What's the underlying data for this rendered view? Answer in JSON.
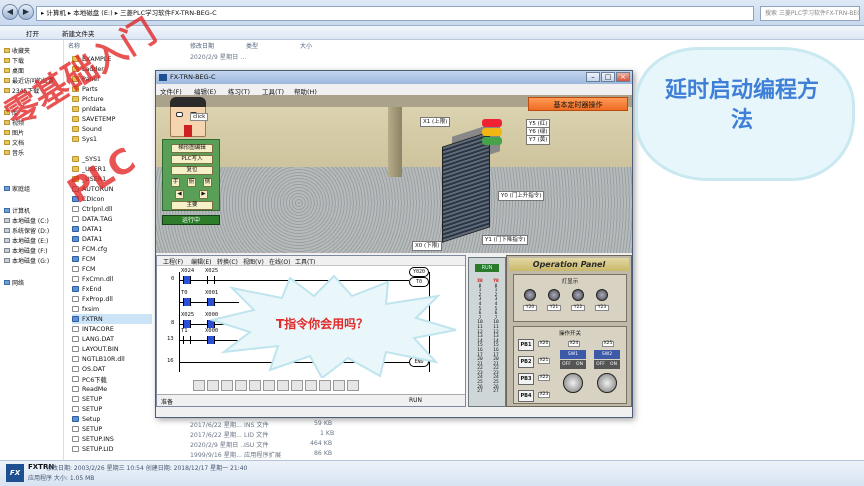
{
  "explorer": {
    "address": "▸ 计算机 ▸ 本地磁盘 (E:) ▸ 三菱PLC学习软件FX-TRN-BEG-C",
    "search_placeholder": "搜索 三菱PLC学习软件FX-TRN-BEG-C",
    "toolbar": {
      "open": "打开",
      "new_folder": "新建文件夹"
    },
    "columns": {
      "name": "名称",
      "date": "修改日期",
      "type": "类型",
      "size": "大小"
    },
    "sidebar": [
      "收藏夹",
      "下载",
      "桌面",
      "最近访问的位置",
      "2345下载",
      "库",
      "视频",
      "图片",
      "文档",
      "音乐",
      "家庭组",
      "计算机",
      "本地磁盘 (C:)",
      "系统保留 (D:)",
      "本地磁盘 (E:)",
      "本地磁盘 (F:)",
      "本地磁盘 (G:)",
      "网络"
    ],
    "files": [
      "EXAMPLE",
      "Ladder",
      "Panel",
      "Parts",
      "Picture",
      "pnldata",
      "SAVETEMP",
      "Sound",
      "Sys1",
      "_SYS1",
      "_USER1",
      "_USER1",
      "AUTORUN",
      "CDIcon",
      "Ctrlpnl.dll",
      "DATA.TAG",
      "DATA1",
      "DATA1",
      "FCM.cfg",
      "FCM",
      "FCM",
      "FxCmn.dll",
      "FxEnd",
      "FxProp.dll",
      "fxsim",
      "FXTRN",
      "INTACORE",
      "LANG.DAT",
      "LAYOUT.BIN",
      "NGTLB10R.dll",
      "OS.DAT",
      "PC6下载",
      "ReadMe",
      "SETUP",
      "SETUP",
      "Setup",
      "SETUP",
      "SETUP.INS",
      "SETUP.LID",
      "Uninst.isu",
      "Vlapi.dll"
    ],
    "details": [
      {
        "date": "2017/6/22 星期...",
        "type": "INS 文件",
        "size": "59 KB"
      },
      {
        "date": "2017/6/22 星期...",
        "type": "LID 文件",
        "size": "1 KB"
      },
      {
        "date": "2020/2/9 星期日 ...",
        "type": "ISU 文件",
        "size": "464 KB"
      },
      {
        "date": "1999/9/16 星期...",
        "type": "应用程序扩展",
        "size": "86 KB"
      }
    ],
    "top_detail": "2020/2/9 星期日 ...",
    "status": {
      "icon_text": "FX",
      "name": "FXTRN",
      "line1": "修改日期: 2003/2/26 星期三 10:54 创建日期: 2018/12/17 星期一 21:40",
      "line2": "应用程序    大小: 1.05 MB"
    }
  },
  "trn": {
    "title": "FX-TRN-BEG-C",
    "menu": [
      "文件(F)",
      "编辑(E)",
      "练习(T)",
      "工具(T)",
      "帮助(H)"
    ],
    "banner": "基本定时器操作",
    "scene_labels": {
      "x1": "X1 (上限)",
      "y5": "Y5 (红)",
      "y6": "Y6 (绿)",
      "y7": "Y7 (黄)",
      "y0": "Y0 (门上升指令)",
      "y1": "Y1 (门下降指令)",
      "x0": "X0 (下限)"
    },
    "remote": {
      "click": "click",
      "buttons": [
        "梯形图编辑",
        "PLC写入",
        "复位"
      ],
      "view_row": [
        "手",
        "俯",
        "侧"
      ],
      "nav": [
        "◀",
        "▶"
      ],
      "main": "主要",
      "running": "运行中"
    },
    "ladder": {
      "menu": [
        "工程(F)",
        "编辑(E)",
        "转换(C)",
        "视图(V)",
        "在线(O)",
        "工具(T)"
      ],
      "rungs": [
        {
          "step": "0",
          "contacts": [
            "X024",
            "X025"
          ],
          "coil": "Y020"
        },
        {
          "step": "",
          "contacts": [
            "T0",
            "X001"
          ],
          "coil": ""
        },
        {
          "step": "8",
          "contacts": [
            "X025",
            "X000"
          ],
          "coil": ""
        },
        {
          "step": "13",
          "contacts": [
            "T1",
            "X000"
          ],
          "coil": ""
        },
        {
          "step": "16",
          "contacts": [],
          "coil": "END"
        }
      ],
      "coil_sub": "T0",
      "status_left": "准备",
      "status_run": "RUN"
    },
    "plc": {
      "run": "RUN",
      "x_head": "X0",
      "y_head": "Y0",
      "x_nums": [
        "0",
        "1",
        "2",
        "3",
        "4",
        "5",
        "6",
        "7",
        "10",
        "11",
        "12",
        "13",
        "14",
        "15",
        "16",
        "17",
        "20",
        "21",
        "22",
        "23",
        "24",
        "25",
        "26",
        "27"
      ],
      "y_nums": [
        "0",
        "1",
        "2",
        "3",
        "4",
        "5",
        "6",
        "7",
        "10",
        "11",
        "12",
        "13",
        "14",
        "15",
        "16",
        "17",
        "20",
        "21",
        "22",
        "23",
        "24",
        "25",
        "26",
        "27"
      ]
    },
    "op_panel": {
      "title": "Operation Panel",
      "lamps_title": "灯显示",
      "lamp_labels": [
        "Y20",
        "Y21",
        "Y22",
        "Y23"
      ],
      "switch_title": "操作开关",
      "pb": [
        "PB1",
        "PB2",
        "PB3",
        "PB4"
      ],
      "pb_tags": [
        "X20",
        "X21",
        "X22",
        "X23"
      ],
      "sw_tags": [
        "X24",
        "X25"
      ],
      "sw_labels": [
        "SW1",
        "SW2"
      ],
      "off_on": [
        "OFF",
        "ON"
      ]
    }
  },
  "overlay": {
    "cloud_text": "延时启动编程方法",
    "burst_text": "T指令你会用吗？",
    "stamp1": "零基础入门",
    "stamp2": "PLC"
  },
  "colors": {
    "cloud_text": "#3f7fd8",
    "burst_text": "#e02a2a",
    "stamp": "#e12323"
  }
}
